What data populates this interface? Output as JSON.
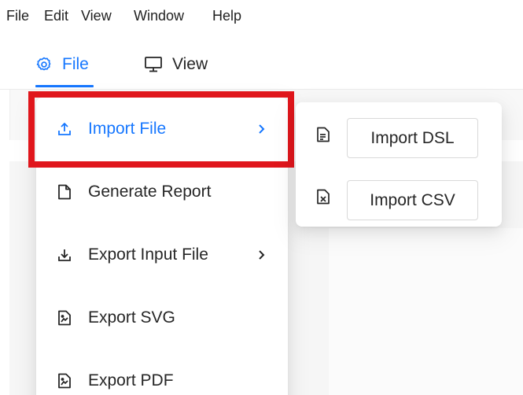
{
  "menubar": {
    "items": [
      "File",
      "Edit",
      "View",
      "Window",
      "Help"
    ]
  },
  "tabs": [
    {
      "label": "File",
      "icon": "gear-icon",
      "active": true
    },
    {
      "label": "View",
      "icon": "monitor-icon",
      "active": false
    }
  ],
  "dropdown": {
    "items": [
      {
        "label": "Import File",
        "icon": "upload-icon",
        "has_submenu": true,
        "active": true
      },
      {
        "label": "Generate Report",
        "icon": "file-icon",
        "has_submenu": false,
        "active": false
      },
      {
        "label": "Export Input File",
        "icon": "download-icon",
        "has_submenu": true,
        "active": false
      },
      {
        "label": "Export SVG",
        "icon": "file-image-icon",
        "has_submenu": false,
        "active": false
      },
      {
        "label": "Export PDF",
        "icon": "file-image-icon",
        "has_submenu": false,
        "active": false
      }
    ]
  },
  "submenu": {
    "items": [
      {
        "label": "Import DSL",
        "icon": "file-text-icon"
      },
      {
        "label": "Import CSV",
        "icon": "file-excel-icon"
      }
    ]
  },
  "colors": {
    "accent": "#1677ff",
    "highlight": "#e0161c",
    "text": "#262626"
  }
}
